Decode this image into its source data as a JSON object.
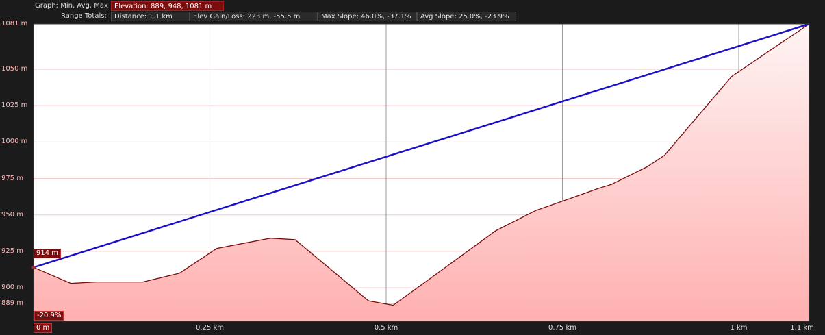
{
  "header": {
    "row1_label": "Graph: Min, Avg, Max",
    "elevation_stat": "Elevation: 889, 948, 1081 m",
    "row2_label": "Range Totals:",
    "distance": "Distance: 1.1 km",
    "elev_gain_loss": "Elev Gain/Loss: 223 m, -55.5 m",
    "max_slope": "Max Slope: 46.0%, -37.1%",
    "avg_slope": "Avg Slope: 25.0%, -23.9%"
  },
  "markers": {
    "start_elevation": "914 m",
    "slope": "-20.9%",
    "range_start": "0 m"
  },
  "colors": {
    "fill_top": "#fff4f4",
    "fill_bottom": "#ffb0b0",
    "profile_line": "#7a0a0a",
    "slope_line": "#1a10c8",
    "grid": "#f3c8c8",
    "accent": "#7a0d0d"
  },
  "chart_data": {
    "type": "area",
    "xlabel": "",
    "ylabel": "",
    "x_unit": "km",
    "y_unit": "m",
    "xlim": [
      0,
      1.1
    ],
    "ylim": [
      877,
      1081
    ],
    "grid": true,
    "y_ticks": [
      {
        "value": 1081,
        "label": "1081 m"
      },
      {
        "value": 1050,
        "label": "1050 m"
      },
      {
        "value": 1025,
        "label": "1025 m"
      },
      {
        "value": 1000,
        "label": "1000 m"
      },
      {
        "value": 975,
        "label": "975 m"
      },
      {
        "value": 950,
        "label": "950 m"
      },
      {
        "value": 925,
        "label": "925 m"
      },
      {
        "value": 900,
        "label": "900 m"
      },
      {
        "value": 889,
        "label": "889 m"
      }
    ],
    "x_ticks": [
      {
        "value": 0.25,
        "label": "0.25 km"
      },
      {
        "value": 0.5,
        "label": "0.5 km"
      },
      {
        "value": 0.75,
        "label": "0.75 km"
      },
      {
        "value": 1.0,
        "label": "1 km"
      },
      {
        "value": 1.1,
        "label": "1.1 km"
      }
    ],
    "series": [
      {
        "x": [
          0,
          0.053,
          0.088,
          0.155,
          0.207,
          0.26,
          0.336,
          0.371,
          0.475,
          0.51,
          0.57,
          0.655,
          0.712,
          0.765,
          0.8,
          0.82,
          0.87,
          0.895,
          0.93,
          0.99,
          1.06,
          1.1
        ],
        "y": [
          914,
          903,
          904,
          904,
          910,
          927,
          934,
          933,
          891,
          888,
          909,
          939,
          953,
          962,
          968,
          971,
          983,
          991,
          1011,
          1045,
          1068,
          1081
        ]
      }
    ],
    "slope_line": {
      "x": [
        0,
        1.1
      ],
      "y": [
        914,
        1081
      ]
    }
  }
}
